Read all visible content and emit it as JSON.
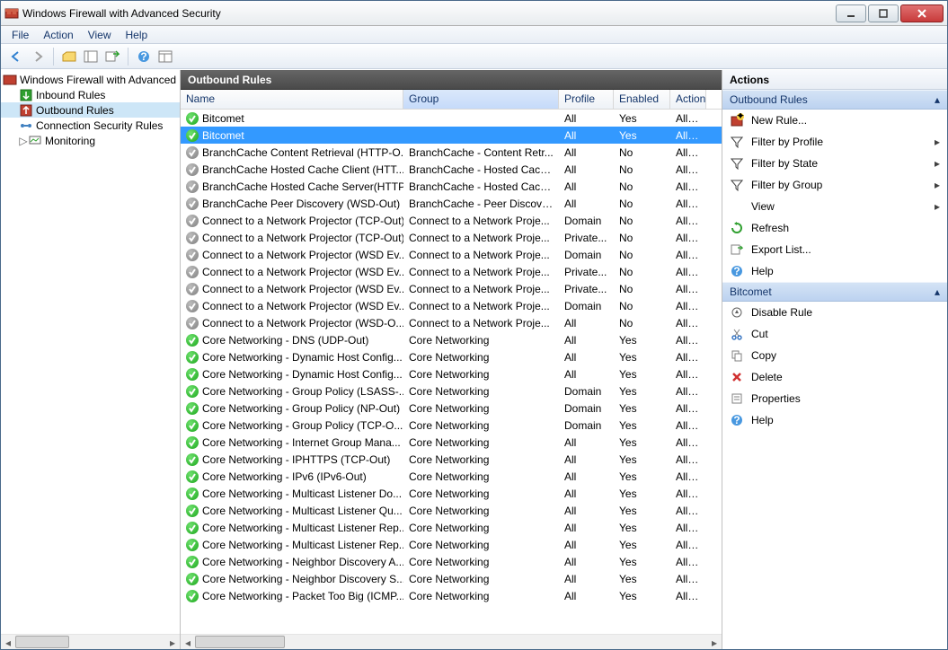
{
  "window": {
    "title": "Windows Firewall with Advanced Security"
  },
  "menu": {
    "file": "File",
    "action": "Action",
    "view": "View",
    "help": "Help"
  },
  "tree": {
    "root": "Windows Firewall with Advanced Security",
    "inbound": "Inbound Rules",
    "outbound": "Outbound Rules",
    "csr": "Connection Security Rules",
    "monitoring": "Monitoring"
  },
  "list": {
    "header": "Outbound Rules",
    "cols": {
      "name": "Name",
      "group": "Group",
      "profile": "Profile",
      "enabled": "Enabled",
      "action": "Action"
    },
    "rules": [
      {
        "enabled": true,
        "name": "Bitcomet",
        "group": "",
        "profile": "All",
        "en": "Yes",
        "action": "Allow",
        "selected": false
      },
      {
        "enabled": true,
        "name": "Bitcomet",
        "group": "",
        "profile": "All",
        "en": "Yes",
        "action": "Allow",
        "selected": true
      },
      {
        "enabled": false,
        "name": "BranchCache Content Retrieval (HTTP-O...",
        "group": "BranchCache - Content Retr...",
        "profile": "All",
        "en": "No",
        "action": "Allow"
      },
      {
        "enabled": false,
        "name": "BranchCache Hosted Cache Client (HTT...",
        "group": "BranchCache - Hosted Cach...",
        "profile": "All",
        "en": "No",
        "action": "Allow"
      },
      {
        "enabled": false,
        "name": "BranchCache Hosted Cache Server(HTTP...",
        "group": "BranchCache - Hosted Cach...",
        "profile": "All",
        "en": "No",
        "action": "Allow"
      },
      {
        "enabled": false,
        "name": "BranchCache Peer Discovery (WSD-Out)",
        "group": "BranchCache - Peer Discove...",
        "profile": "All",
        "en": "No",
        "action": "Allow"
      },
      {
        "enabled": false,
        "name": "Connect to a Network Projector (TCP-Out)",
        "group": "Connect to a Network Proje...",
        "profile": "Domain",
        "en": "No",
        "action": "Allow"
      },
      {
        "enabled": false,
        "name": "Connect to a Network Projector (TCP-Out)",
        "group": "Connect to a Network Proje...",
        "profile": "Private...",
        "en": "No",
        "action": "Allow"
      },
      {
        "enabled": false,
        "name": "Connect to a Network Projector (WSD Ev...",
        "group": "Connect to a Network Proje...",
        "profile": "Domain",
        "en": "No",
        "action": "Allow"
      },
      {
        "enabled": false,
        "name": "Connect to a Network Projector (WSD Ev...",
        "group": "Connect to a Network Proje...",
        "profile": "Private...",
        "en": "No",
        "action": "Allow"
      },
      {
        "enabled": false,
        "name": "Connect to a Network Projector (WSD Ev...",
        "group": "Connect to a Network Proje...",
        "profile": "Private...",
        "en": "No",
        "action": "Allow"
      },
      {
        "enabled": false,
        "name": "Connect to a Network Projector (WSD Ev...",
        "group": "Connect to a Network Proje...",
        "profile": "Domain",
        "en": "No",
        "action": "Allow"
      },
      {
        "enabled": false,
        "name": "Connect to a Network Projector (WSD-O...",
        "group": "Connect to a Network Proje...",
        "profile": "All",
        "en": "No",
        "action": "Allow"
      },
      {
        "enabled": true,
        "name": "Core Networking - DNS (UDP-Out)",
        "group": "Core Networking",
        "profile": "All",
        "en": "Yes",
        "action": "Allow"
      },
      {
        "enabled": true,
        "name": "Core Networking - Dynamic Host Config...",
        "group": "Core Networking",
        "profile": "All",
        "en": "Yes",
        "action": "Allow"
      },
      {
        "enabled": true,
        "name": "Core Networking - Dynamic Host Config...",
        "group": "Core Networking",
        "profile": "All",
        "en": "Yes",
        "action": "Allow"
      },
      {
        "enabled": true,
        "name": "Core Networking - Group Policy (LSASS-...",
        "group": "Core Networking",
        "profile": "Domain",
        "en": "Yes",
        "action": "Allow"
      },
      {
        "enabled": true,
        "name": "Core Networking - Group Policy (NP-Out)",
        "group": "Core Networking",
        "profile": "Domain",
        "en": "Yes",
        "action": "Allow"
      },
      {
        "enabled": true,
        "name": "Core Networking - Group Policy (TCP-O...",
        "group": "Core Networking",
        "profile": "Domain",
        "en": "Yes",
        "action": "Allow"
      },
      {
        "enabled": true,
        "name": "Core Networking - Internet Group Mana...",
        "group": "Core Networking",
        "profile": "All",
        "en": "Yes",
        "action": "Allow"
      },
      {
        "enabled": true,
        "name": "Core Networking - IPHTTPS (TCP-Out)",
        "group": "Core Networking",
        "profile": "All",
        "en": "Yes",
        "action": "Allow"
      },
      {
        "enabled": true,
        "name": "Core Networking - IPv6 (IPv6-Out)",
        "group": "Core Networking",
        "profile": "All",
        "en": "Yes",
        "action": "Allow"
      },
      {
        "enabled": true,
        "name": "Core Networking - Multicast Listener Do...",
        "group": "Core Networking",
        "profile": "All",
        "en": "Yes",
        "action": "Allow"
      },
      {
        "enabled": true,
        "name": "Core Networking - Multicast Listener Qu...",
        "group": "Core Networking",
        "profile": "All",
        "en": "Yes",
        "action": "Allow"
      },
      {
        "enabled": true,
        "name": "Core Networking - Multicast Listener Rep...",
        "group": "Core Networking",
        "profile": "All",
        "en": "Yes",
        "action": "Allow"
      },
      {
        "enabled": true,
        "name": "Core Networking - Multicast Listener Rep...",
        "group": "Core Networking",
        "profile": "All",
        "en": "Yes",
        "action": "Allow"
      },
      {
        "enabled": true,
        "name": "Core Networking - Neighbor Discovery A...",
        "group": "Core Networking",
        "profile": "All",
        "en": "Yes",
        "action": "Allow"
      },
      {
        "enabled": true,
        "name": "Core Networking - Neighbor Discovery S...",
        "group": "Core Networking",
        "profile": "All",
        "en": "Yes",
        "action": "Allow"
      },
      {
        "enabled": true,
        "name": "Core Networking - Packet Too Big (ICMP...",
        "group": "Core Networking",
        "profile": "All",
        "en": "Yes",
        "action": "Allow"
      }
    ]
  },
  "actions": {
    "header": "Actions",
    "sect1": "Outbound Rules",
    "new_rule": "New Rule...",
    "filter_profile": "Filter by Profile",
    "filter_state": "Filter by State",
    "filter_group": "Filter by Group",
    "view": "View",
    "refresh": "Refresh",
    "export": "Export List...",
    "help": "Help",
    "sect2": "Bitcomet",
    "disable": "Disable Rule",
    "cut": "Cut",
    "copy": "Copy",
    "delete": "Delete",
    "properties": "Properties",
    "help2": "Help"
  }
}
